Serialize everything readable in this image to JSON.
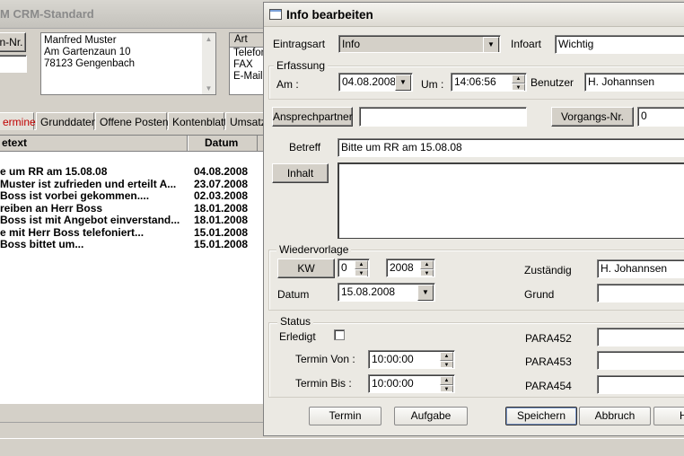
{
  "background_window": {
    "title": "M CRM-Standard",
    "kunden_button": "n-Nr.",
    "address_lines": [
      "Manfred Muster",
      "Am Gartenzaun 10",
      "78123  Gengenbach"
    ],
    "contact_header": "Art",
    "contact_items": [
      "Telefon",
      "FAX",
      "E-Mail"
    ],
    "tabs": [
      "ermine",
      "Grunddaten",
      "Offene Posten",
      "Kontenblatt",
      "Umsatz"
    ],
    "list_headers": {
      "text": "etext",
      "datum": "Datum"
    },
    "rows": [
      {
        "text": "e um RR am 15.08.08",
        "date": "04.08.2008"
      },
      {
        "text": " Muster ist zufrieden und erteilt A...",
        "date": "23.07.2008"
      },
      {
        "text": " Boss ist vorbei gekommen....",
        "date": "02.03.2008"
      },
      {
        "text": "reiben an Herr Boss",
        "date": "18.01.2008"
      },
      {
        "text": " Boss ist mit Angebot einverstand...",
        "date": "18.01.2008"
      },
      {
        "text": "e mit Herr Boss telefoniert...",
        "date": "15.01.2008"
      },
      {
        "text": " Boss bittet um...",
        "date": "15.01.2008"
      }
    ]
  },
  "dialog": {
    "title": "Info bearbeiten",
    "eintragsart_label": "Eintragsart",
    "eintragsart_value": "Info",
    "infoart_label": "Infoart",
    "infoart_value": "Wichtig",
    "erfassung_group": "Erfassung",
    "am_label": "Am :",
    "am_value": "04.08.2008",
    "um_label": "Um :",
    "um_value": "14:06:56",
    "benutzer_label": "Benutzer",
    "benutzer_value": "H. Johannsen",
    "ansprechpartner_button": "Ansprechpartner",
    "ansprechpartner_value": "",
    "vorgangs_button": "Vorgangs-Nr.",
    "vorgangs_value": "0",
    "betreff_label": "Betreff",
    "betreff_value": "Bitte um RR am 15.08.08",
    "inhalt_button": "Inhalt",
    "inhalt_value": "",
    "wiedervorlage_group": "Wiedervorlage",
    "kw_button": "KW",
    "kw_value": "0",
    "year_value": "2008",
    "datum_label": "Datum",
    "datum_value": "15.08.2008",
    "zustaendig_label": "Zuständig",
    "zustaendig_value": "H. Johannsen",
    "grund_label": "Grund",
    "grund_value": "",
    "status_group": "Status",
    "erledigt_label": "Erledigt",
    "termin_von_label": "Termin Von :",
    "termin_von_value": "10:00:00",
    "termin_bis_label": "Termin Bis :",
    "termin_bis_value": "10:00:00",
    "para452_label": "PARA452",
    "para453_label": "PARA453",
    "para454_label": "PARA454",
    "buttons": {
      "termin": "Termin",
      "aufgabe": "Aufgabe",
      "speichern": "Speichern",
      "abbruch": "Abbruch",
      "hilfe": "H"
    }
  }
}
